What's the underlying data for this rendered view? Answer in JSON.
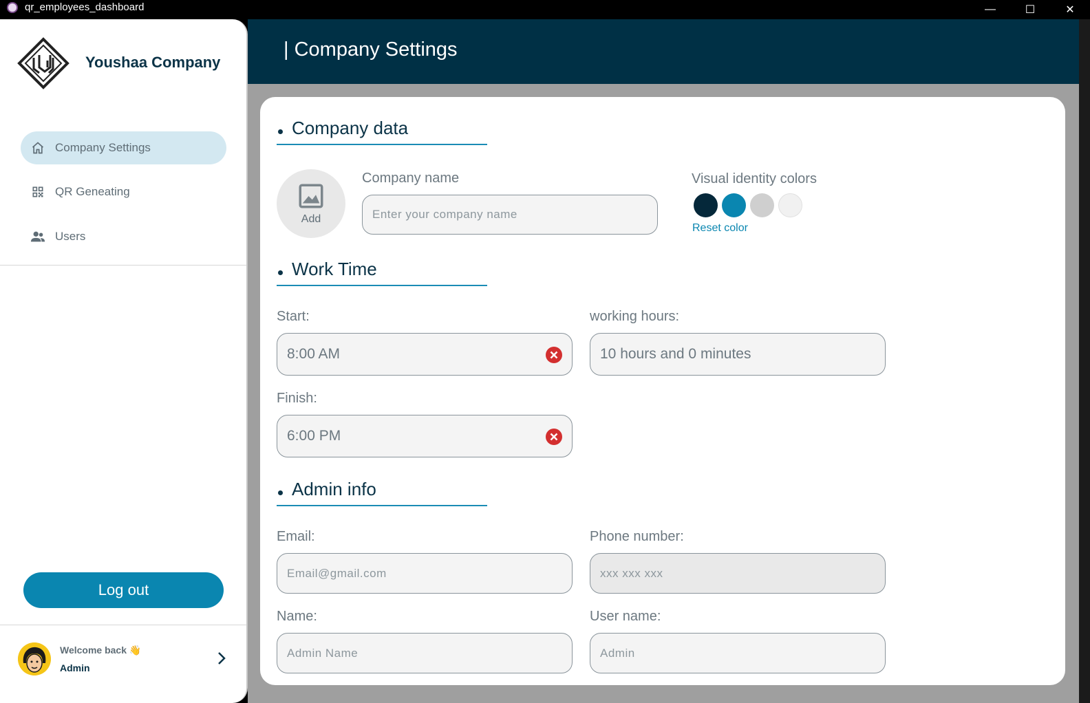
{
  "window": {
    "title": "qr_employees_dashboard",
    "minimize_glyph": "—",
    "maximize_glyph": "☐",
    "close_glyph": "✕"
  },
  "sidebar": {
    "company_name": "Youshaa Company",
    "nav": [
      {
        "label": "Company Settings",
        "icon": "home-icon",
        "active": true
      },
      {
        "label": "QR Geneating",
        "icon": "qr-code-icon",
        "active": false
      },
      {
        "label": "Users",
        "icon": "users-icon",
        "active": false
      }
    ],
    "logout_label": "Log out",
    "welcome_text": "Welcome back 👋",
    "user_role": "Admin"
  },
  "header": {
    "title": "| Company Settings"
  },
  "company_data": {
    "section_title": "Company data",
    "add_image_label": "Add",
    "company_name_label": "Company name",
    "company_name_placeholder": "Enter your company name",
    "colors_label": "Visual identity colors",
    "colors": [
      "#05283a",
      "#0a86b0",
      "#cfcfcf",
      "#f1f1f1"
    ],
    "reset_color_label": "Reset color"
  },
  "work_time": {
    "section_title": "Work Time",
    "start_label": "Start:",
    "start_value": "8:00 AM",
    "working_hours_label": "working hours:",
    "working_hours_value": "10 hours and 0 minutes",
    "finish_label": "Finish:",
    "finish_value": "6:00 PM"
  },
  "admin_info": {
    "section_title": "Admin info",
    "email_label": "Email:",
    "email_placeholder": "Email@gmail.com",
    "phone_label": "Phone number:",
    "phone_placeholder": "xxx xxx xxx",
    "name_label": "Name:",
    "name_placeholder": "Admin Name",
    "username_label": "User name:",
    "username_placeholder": "Admin"
  },
  "theme": {
    "header_bg": "#003045",
    "accent": "#0a86b0",
    "error": "#d32f2f"
  }
}
